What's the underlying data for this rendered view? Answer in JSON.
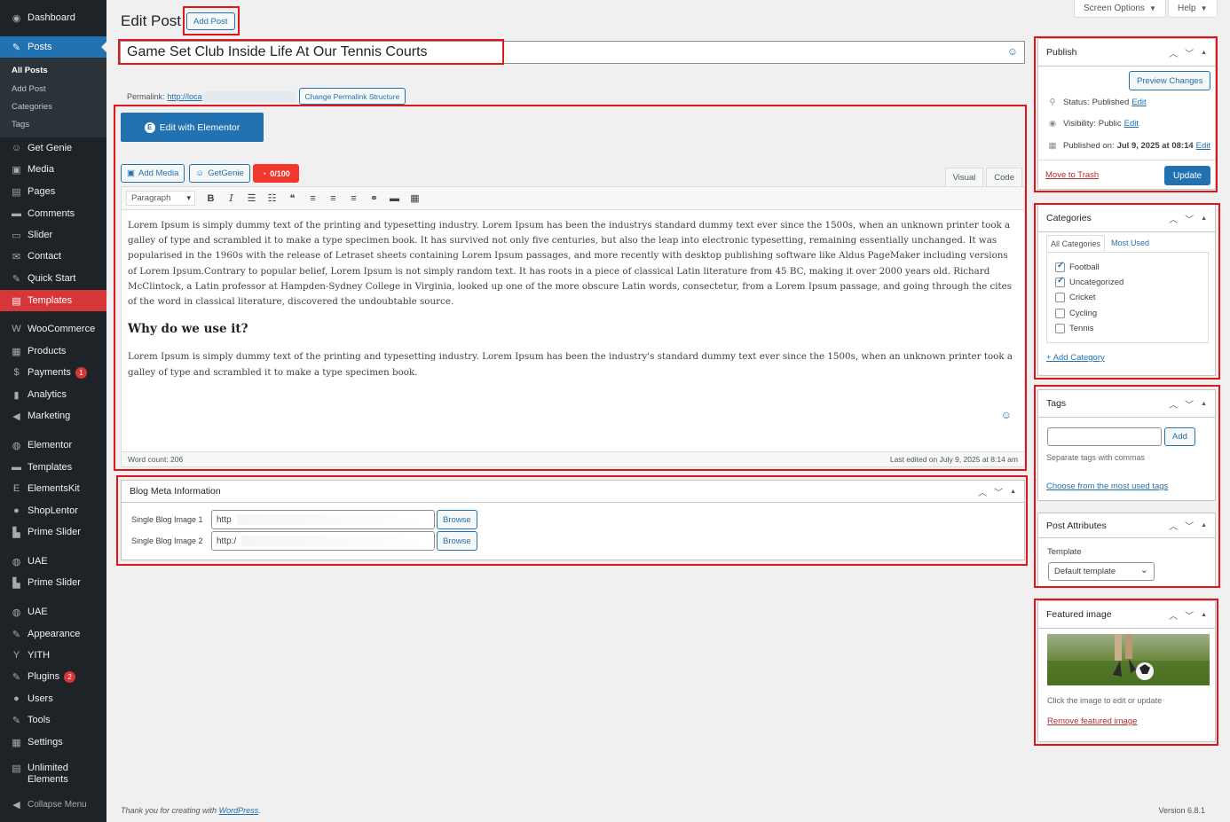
{
  "sidebar": {
    "items": [
      {
        "label": "Dashboard",
        "icon": "dashboard-icon",
        "glyph": "◉"
      },
      {
        "label": "Posts",
        "icon": "pin-icon",
        "glyph": "✎"
      },
      {
        "label": "Get Genie",
        "icon": "genie-icon",
        "glyph": "☺"
      },
      {
        "label": "Media",
        "icon": "media-icon",
        "glyph": "▣"
      },
      {
        "label": "Pages",
        "icon": "pages-icon",
        "glyph": "▤"
      },
      {
        "label": "Comments",
        "icon": "comments-icon",
        "glyph": "▬"
      },
      {
        "label": "Slider",
        "icon": "slider-icon",
        "glyph": "▭"
      },
      {
        "label": "Contact",
        "icon": "mail-icon",
        "glyph": "✉"
      },
      {
        "label": "Quick Start",
        "icon": "wrench-icon",
        "glyph": "✎"
      },
      {
        "label": "Templates",
        "icon": "templates-icon",
        "glyph": "▤"
      },
      {
        "label": "WooCommerce",
        "icon": "woo-icon",
        "glyph": "W"
      },
      {
        "label": "Products",
        "icon": "products-icon",
        "glyph": "▦"
      },
      {
        "label": "Payments",
        "icon": "payments-icon",
        "glyph": "$",
        "badge": "1"
      },
      {
        "label": "Analytics",
        "icon": "analytics-icon",
        "glyph": "▮"
      },
      {
        "label": "Marketing",
        "icon": "megaphone-icon",
        "glyph": "◀"
      },
      {
        "label": "Elementor",
        "icon": "elementor-icon",
        "glyph": "◍"
      },
      {
        "label": "Templates",
        "icon": "folder-icon",
        "glyph": "▬"
      },
      {
        "label": "ElementsKit",
        "icon": "elementskit-icon",
        "glyph": "Ε"
      },
      {
        "label": "ShopLentor",
        "icon": "shoplentor-icon",
        "glyph": "●"
      },
      {
        "label": "Prime Slider",
        "icon": "prime-slider-icon",
        "glyph": "▙"
      },
      {
        "label": "UAE",
        "icon": "uae-icon",
        "glyph": "◍"
      },
      {
        "label": "Prime Slider",
        "icon": "prime-slider-icon",
        "glyph": "▙"
      },
      {
        "label": "UAE",
        "icon": "uae-icon",
        "glyph": "◍"
      },
      {
        "label": "Appearance",
        "icon": "brush-icon",
        "glyph": "✎"
      },
      {
        "label": "YITH",
        "icon": "yith-icon",
        "glyph": "Y"
      },
      {
        "label": "Plugins",
        "icon": "plugins-icon",
        "glyph": "✎",
        "badge": "2"
      },
      {
        "label": "Users",
        "icon": "users-icon",
        "glyph": "●"
      },
      {
        "label": "Tools",
        "icon": "tools-icon",
        "glyph": "✎"
      },
      {
        "label": "Settings",
        "icon": "settings-icon",
        "glyph": "▦"
      }
    ],
    "unlimited_line1": "Unlimited",
    "unlimited_line2": "Elements",
    "collapse": "Collapse Menu",
    "sub_items": [
      "All Posts",
      "Add Post",
      "Categories",
      "Tags"
    ]
  },
  "top": {
    "screen_options": "Screen Options",
    "help": "Help",
    "page_title": "Edit Post",
    "add_post": "Add Post"
  },
  "post": {
    "title": "Game Set Club Inside Life At Our Tennis Courts",
    "permalink_label": "Permalink:",
    "permalink_url": "http://loca",
    "change_permalink": "Change Permalink Structure"
  },
  "editor": {
    "elementor_button": "Edit with Elementor",
    "add_media": "Add Media",
    "getgenie": "GetGenie",
    "score": "0/100",
    "tab_visual": "Visual",
    "tab_code": "Code",
    "format": "Paragraph",
    "paragraph1": "Lorem Ipsum is simply dummy text of the printing and typesetting industry. Lorem Ipsum has been the industrys standard dummy text ever since the 1500s, when an unknown printer took a galley of type and scrambled it to make a type specimen book. It has survived not only five centuries, but also the leap into electronic typesetting, remaining essentially unchanged. It was popularised in the 1960s with the release of Letraset sheets containing Lorem Ipsum passages, and more recently with desktop publishing software like Aldus PageMaker including versions of Lorem Ipsum.Contrary to popular belief, Lorem Ipsum is not simply random text. It has roots in a piece of classical Latin literature from 45 BC, making it over 2000 years old. Richard McClintock, a Latin professor at Hampden-Sydney College in Virginia, looked up one of the more obscure Latin words, consectetur, from a Lorem Ipsum passage, and going through the cites of the word in classical literature, discovered the undoubtable source.",
    "heading": "Why do we use it?",
    "paragraph2": "Lorem Ipsum is simply dummy text of the printing and typesetting industry. Lorem Ipsum has been the industry's standard dummy text ever since the 1500s, when an unknown printer took a galley of type and scrambled it to make a type specimen book.",
    "word_count": "Word count: 206",
    "last_edited": "Last edited on July 9, 2025 at 8:14 am"
  },
  "blog_meta": {
    "title": "Blog Meta Information",
    "label1": "Single Blog Image 1",
    "value1": "http",
    "label2": "Single Blog Image 2",
    "value2": "http:/",
    "browse": "Browse"
  },
  "publish": {
    "title": "Publish",
    "preview": "Preview Changes",
    "status_label": "Status:",
    "status_value": "Published",
    "visibility_label": "Visibility:",
    "visibility_value": "Public",
    "published_label": "Published on:",
    "published_value": "Jul 9, 2025 at 08:14",
    "edit": "Edit",
    "trash": "Move to Trash",
    "update": "Update"
  },
  "categories": {
    "title": "Categories",
    "tab_all": "All Categories",
    "tab_used": "Most Used",
    "items": [
      {
        "label": "Football",
        "checked": true
      },
      {
        "label": "Uncategorized",
        "checked": true
      },
      {
        "label": "Cricket",
        "checked": false
      },
      {
        "label": "Cycling",
        "checked": false
      },
      {
        "label": "Tennis",
        "checked": false
      }
    ],
    "add": "+ Add Category"
  },
  "tags": {
    "title": "Tags",
    "add": "Add",
    "hint": "Separate tags with commas",
    "choose": "Choose from the most used tags"
  },
  "post_attributes": {
    "title": "Post Attributes",
    "template_label": "Template",
    "template_value": "Default template"
  },
  "featured": {
    "title": "Featured image",
    "hint": "Click the image to edit or update",
    "remove": "Remove featured image"
  },
  "footer": {
    "thanks": "Thank you for creating with",
    "wordpress": "WordPress",
    "version": "Version 6.8.1"
  },
  "colors": {
    "sidebar": "#1d2327",
    "accent": "#2271b1",
    "highlight": "#d63638",
    "annotation": "#e0161e"
  }
}
